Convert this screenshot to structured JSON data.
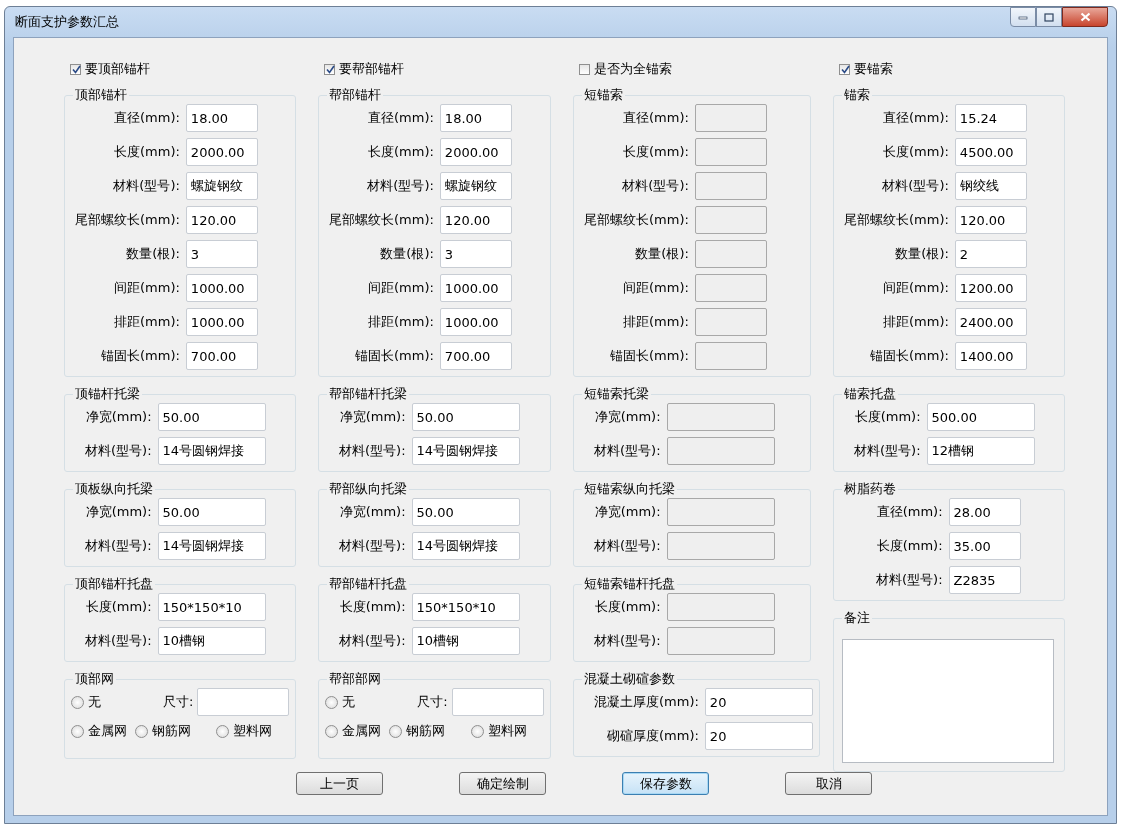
{
  "window": {
    "title": "断面支护参数汇总"
  },
  "columns": [
    {
      "checkbox": {
        "label": "要顶部锚杆",
        "checked": true
      },
      "groups": [
        {
          "title": "顶部锚杆",
          "kind": "fields",
          "fields": [
            {
              "label": "直径(mm):",
              "value": "18.00",
              "disabled": false
            },
            {
              "label": "长度(mm):",
              "value": "2000.00",
              "disabled": false
            },
            {
              "label": "材料(型号):",
              "value": "螺旋钢纹",
              "disabled": false
            },
            {
              "label": "尾部螺纹长(mm):",
              "value": "120.00",
              "disabled": false
            },
            {
              "label": "数量(根):",
              "value": "3",
              "disabled": false
            },
            {
              "label": "间距(mm):",
              "value": "1000.00",
              "disabled": false
            },
            {
              "label": "排距(mm):",
              "value": "1000.00",
              "disabled": false
            },
            {
              "label": "锚固长(mm):",
              "value": "700.00",
              "disabled": false
            }
          ]
        },
        {
          "title": "顶锚杆托梁",
          "kind": "fields",
          "fields": [
            {
              "label": "净宽(mm):",
              "value": "50.00",
              "disabled": false
            },
            {
              "label": "材料(型号):",
              "value": "14号圆钢焊接",
              "disabled": false
            }
          ]
        },
        {
          "title": "顶板纵向托梁",
          "kind": "fields",
          "fields": [
            {
              "label": "净宽(mm):",
              "value": "50.00",
              "disabled": false
            },
            {
              "label": "材料(型号):",
              "value": "14号圆钢焊接",
              "disabled": false
            }
          ]
        },
        {
          "title": "顶部锚杆托盘",
          "kind": "fields",
          "fields": [
            {
              "label": "长度(mm):",
              "value": "150*150*10",
              "disabled": false
            },
            {
              "label": "材料(型号):",
              "value": "10槽钢",
              "disabled": false
            }
          ]
        },
        {
          "title": "顶部网",
          "kind": "mesh",
          "size_label": "尺寸:",
          "radios": [
            {
              "label": "无",
              "selected": false
            },
            {
              "label": "金属网",
              "selected": false
            },
            {
              "label": "钢筋网",
              "selected": false
            },
            {
              "label": "塑料网",
              "selected": false
            }
          ]
        }
      ]
    },
    {
      "checkbox": {
        "label": "要帮部锚杆",
        "checked": true
      },
      "groups": [
        {
          "title": "帮部锚杆",
          "kind": "fields",
          "fields": [
            {
              "label": "直径(mm):",
              "value": "18.00",
              "disabled": false
            },
            {
              "label": "长度(mm):",
              "value": "2000.00",
              "disabled": false
            },
            {
              "label": "材料(型号):",
              "value": "螺旋钢纹",
              "disabled": false
            },
            {
              "label": "尾部螺纹长(mm):",
              "value": "120.00",
              "disabled": false
            },
            {
              "label": "数量(根):",
              "value": "3",
              "disabled": false
            },
            {
              "label": "间距(mm):",
              "value": "1000.00",
              "disabled": false
            },
            {
              "label": "排距(mm):",
              "value": "1000.00",
              "disabled": false
            },
            {
              "label": "锚固长(mm):",
              "value": "700.00",
              "disabled": false
            }
          ]
        },
        {
          "title": "帮部锚杆托梁",
          "kind": "fields",
          "fields": [
            {
              "label": "净宽(mm):",
              "value": "50.00",
              "disabled": false
            },
            {
              "label": "材料(型号):",
              "value": "14号圆钢焊接",
              "disabled": false
            }
          ]
        },
        {
          "title": "帮部纵向托梁",
          "kind": "fields",
          "fields": [
            {
              "label": "净宽(mm):",
              "value": "50.00",
              "disabled": false
            },
            {
              "label": "材料(型号):",
              "value": "14号圆钢焊接",
              "disabled": false
            }
          ]
        },
        {
          "title": "帮部锚杆托盘",
          "kind": "fields",
          "fields": [
            {
              "label": "长度(mm):",
              "value": "150*150*10",
              "disabled": false
            },
            {
              "label": "材料(型号):",
              "value": "10槽钢",
              "disabled": false
            }
          ]
        },
        {
          "title": "帮部部网",
          "kind": "mesh",
          "size_label": "尺寸:",
          "radios": [
            {
              "label": "无",
              "selected": false
            },
            {
              "label": "金属网",
              "selected": false
            },
            {
              "label": "钢筋网",
              "selected": false
            },
            {
              "label": "塑料网",
              "selected": false
            }
          ]
        }
      ]
    },
    {
      "checkbox": {
        "label": "是否为全锚索",
        "checked": false
      },
      "groups": [
        {
          "title": "短锚索",
          "kind": "fields",
          "fields": [
            {
              "label": "直径(mm):",
              "disabled": true
            },
            {
              "label": "长度(mm):",
              "disabled": true
            },
            {
              "label": "材料(型号):",
              "disabled": true
            },
            {
              "label": "尾部螺纹长(mm):",
              "disabled": true
            },
            {
              "label": "数量(根):",
              "disabled": true
            },
            {
              "label": "间距(mm):",
              "disabled": true
            },
            {
              "label": "排距(mm):",
              "disabled": true
            },
            {
              "label": "锚固长(mm):",
              "disabled": true
            }
          ]
        },
        {
          "title": "短锚索托梁",
          "kind": "fields",
          "fields": [
            {
              "label": "净宽(mm):",
              "disabled": true
            },
            {
              "label": "材料(型号):",
              "disabled": true
            }
          ]
        },
        {
          "title": "短锚索纵向托梁",
          "kind": "fields",
          "fields": [
            {
              "label": "净宽(mm):",
              "disabled": true
            },
            {
              "label": "材料(型号):",
              "disabled": true
            }
          ]
        },
        {
          "title": "短锚索锚杆托盘",
          "kind": "fields",
          "fields": [
            {
              "label": "长度(mm):",
              "disabled": true
            },
            {
              "label": "材料(型号):",
              "disabled": true
            }
          ]
        },
        {
          "title": "混凝土砌碹参数",
          "kind": "fields",
          "fields": [
            {
              "label": "混凝土厚度(mm):",
              "value": "20",
              "disabled": false
            },
            {
              "label": "砌碹厚度(mm):",
              "value": "20",
              "disabled": false
            }
          ]
        }
      ]
    },
    {
      "checkbox": {
        "label": "要锚索",
        "checked": true
      },
      "groups": [
        {
          "title": "锚索",
          "kind": "fields",
          "fields": [
            {
              "label": "直径(mm):",
              "value": "15.24",
              "disabled": false
            },
            {
              "label": "长度(mm):",
              "value": "4500.00",
              "disabled": false
            },
            {
              "label": "材料(型号):",
              "value": "钢绞线",
              "disabled": false
            },
            {
              "label": "尾部螺纹长(mm):",
              "value": "120.00",
              "disabled": false
            },
            {
              "label": "数量(根):",
              "value": "2",
              "disabled": false
            },
            {
              "label": "间距(mm):",
              "value": "1200.00",
              "disabled": false
            },
            {
              "label": "排距(mm):",
              "value": "2400.00",
              "disabled": false
            },
            {
              "label": "锚固长(mm):",
              "value": "1400.00",
              "disabled": false
            }
          ]
        },
        {
          "title": "锚索托盘",
          "kind": "fields",
          "fields": [
            {
              "label": "长度(mm):",
              "value": "500.00",
              "disabled": false
            },
            {
              "label": "材料(型号):",
              "value": "12槽钢",
              "disabled": false
            }
          ]
        },
        {
          "title": "树脂药卷",
          "kind": "fields",
          "fields": [
            {
              "label": "直径(mm):",
              "value": "28.00",
              "disabled": false
            },
            {
              "label": "长度(mm):",
              "value": "35.00",
              "disabled": false
            },
            {
              "label": "材料(型号):",
              "value": "Z2835",
              "disabled": false
            }
          ]
        },
        {
          "title": "备注",
          "kind": "notes"
        }
      ]
    }
  ],
  "buttons": [
    {
      "label": "上一页",
      "focused": false
    },
    {
      "label": "确定绘制",
      "focused": false
    },
    {
      "label": "保存参数",
      "focused": true
    },
    {
      "label": "取消",
      "focused": false
    }
  ]
}
